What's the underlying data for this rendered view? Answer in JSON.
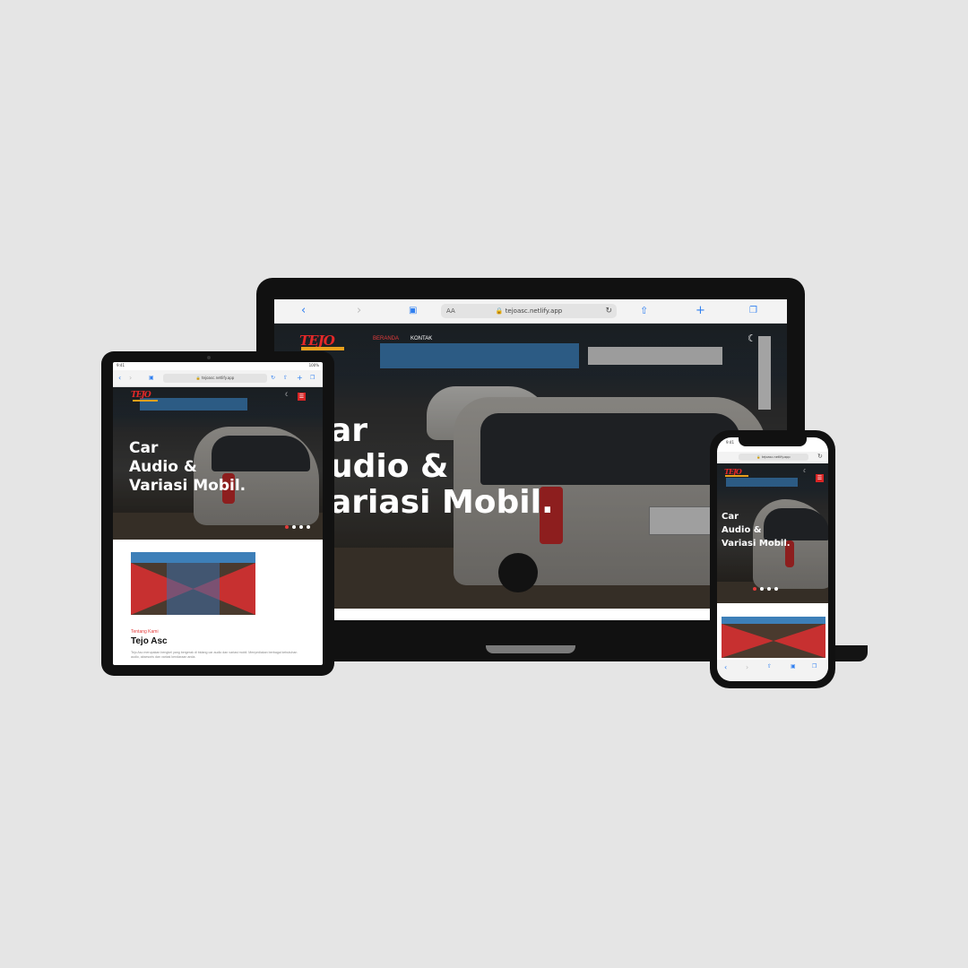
{
  "site": {
    "url": "tejoasc.netlify.app",
    "url_short": "tejoasc.netlify.app",
    "logo_text": "TEJO",
    "hero_title_lines": [
      "Car",
      "Audio &",
      "Variasi Mobil."
    ],
    "laptop_hero_lines": [
      "ar",
      "udio &",
      "ariasi Mobil."
    ],
    "nav": [
      {
        "label": "BERANDA",
        "active": true
      },
      {
        "label": "KONTAK",
        "active": false
      }
    ],
    "menu_icon": "hamburger-icon",
    "slider_dots": 4,
    "slider_active_index": 0
  },
  "browser": {
    "text_size_label": "AA",
    "back_icon": "chevron-left-icon",
    "forward_icon": "chevron-right-icon",
    "reader_icon": "book-icon",
    "lock_icon": "lock-icon",
    "reload_icon": "reload-icon",
    "share_icon": "share-icon",
    "new_tab_icon": "plus-icon",
    "tabs_icon": "tabs-icon"
  },
  "about": {
    "label": "Tentang Kami",
    "title": "Tejo Asc",
    "body": "Tejo Asc merupakan bengkel yang bergerak di bidang car audio dan variasi mobil. Menyediakan berbagai kebutuhan audio, aksesoris dan variasi kendaraan anda."
  },
  "tablet_status": {
    "time": "9:41",
    "battery": "100%"
  },
  "phone_status": {
    "time": "9:41"
  },
  "colors": {
    "accent": "#e23b3b",
    "background": "#e5e5e5",
    "ios_blue": "#2f7ff0",
    "banner_blue": "#3d7fb8"
  }
}
